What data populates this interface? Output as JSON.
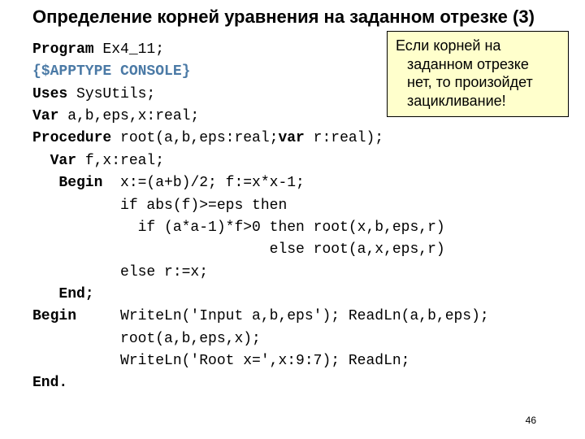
{
  "title": "Определение корней уравнения на заданном отрезке (3)",
  "code": {
    "l1a": "Program",
    "l1b": " Ex4_11;",
    "l2": "{$APPTYPE CONSOLE}",
    "l3a": "Uses",
    "l3b": " SysUtils;",
    "l4a": "Var",
    "l4b": " a,b,eps,x:real;",
    "l5a": "Procedure",
    "l5b": " root(a,b,eps:real;",
    "l5c": "var",
    "l5d": " r:real);",
    "l6a": "  Var",
    "l6b": " f,x:real;",
    "l7a": "   Begin",
    "l7b": "  x:=(a+b)/2; f:=x*x-1;",
    "l8": "          if abs(f)>=eps then",
    "l9": "            if (a*a-1)*f>0 then root(x,b,eps,r)",
    "l10": "                           else root(a,x,eps,r)",
    "l11": "          else r:=x;",
    "l12": "   End;",
    "l13a": "Begin",
    "l13b": "     WriteLn('Input a,b,eps'); ReadLn(a,b,eps);",
    "l14": "          root(a,b,eps,x);",
    "l15": "          WriteLn('Root x=',x:9:7); ReadLn;",
    "l16": "End."
  },
  "callout": {
    "line1": "Если корней на",
    "line2": "заданном отрезке",
    "line3": "нет, то произойдет",
    "line4": "зацикливание!"
  },
  "page_number": "46"
}
